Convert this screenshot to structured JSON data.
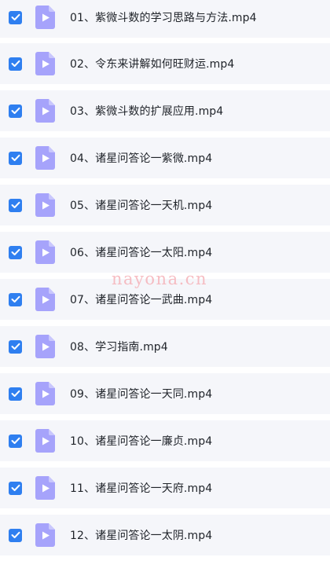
{
  "files": [
    {
      "name": "01、紫微斗数的学习思路与方法.mp4",
      "checked": true
    },
    {
      "name": "02、令东来讲解如何旺财运.mp4",
      "checked": true
    },
    {
      "name": "03、紫微斗数的扩展应用.mp4",
      "checked": true
    },
    {
      "name": "04、诸星问答论一紫微.mp4",
      "checked": true
    },
    {
      "name": "05、诸星问答论一天机.mp4",
      "checked": true
    },
    {
      "name": "06、诸星问答论一太阳.mp4",
      "checked": true
    },
    {
      "name": "07、诸星问答论一武曲.mp4",
      "checked": true
    },
    {
      "name": "08、学习指南.mp4",
      "checked": true
    },
    {
      "name": "09、诸星问答论一天同.mp4",
      "checked": true
    },
    {
      "name": "10、诸星问答论一廉贞.mp4",
      "checked": true
    },
    {
      "name": "11、诸星问答论一天府.mp4",
      "checked": true
    },
    {
      "name": "12、诸星问答论一太阴.mp4",
      "checked": true
    }
  ],
  "icons": {
    "checkbox": "checkbox-checked-icon",
    "file": "video-file-icon"
  },
  "colors": {
    "row_background": "#f5f6fa",
    "checkbox": "#2f7ff0",
    "file_icon": "#a6a3fb",
    "text": "#1f2329",
    "watermark": "#f6b2b9"
  },
  "watermark": "nayona.cn"
}
